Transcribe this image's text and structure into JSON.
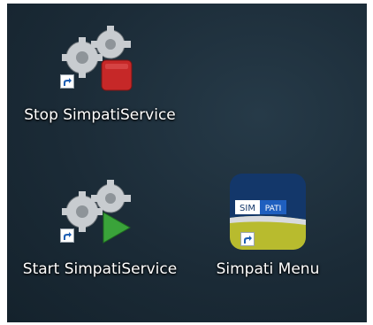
{
  "desktop": {
    "icons": [
      {
        "label": "Stop SimpatiService",
        "icon": "gears-stop-icon",
        "badge_color": "#c62828"
      },
      {
        "label": "Start SimpatiService",
        "icon": "gears-play-icon",
        "badge_color": "#3aa33a"
      },
      {
        "label": "Simpati Menu",
        "icon": "simpati-app-icon",
        "logo_left": "SIM",
        "logo_right": "PATI"
      }
    ],
    "shortcut_overlay": "shortcut-arrow-icon"
  }
}
